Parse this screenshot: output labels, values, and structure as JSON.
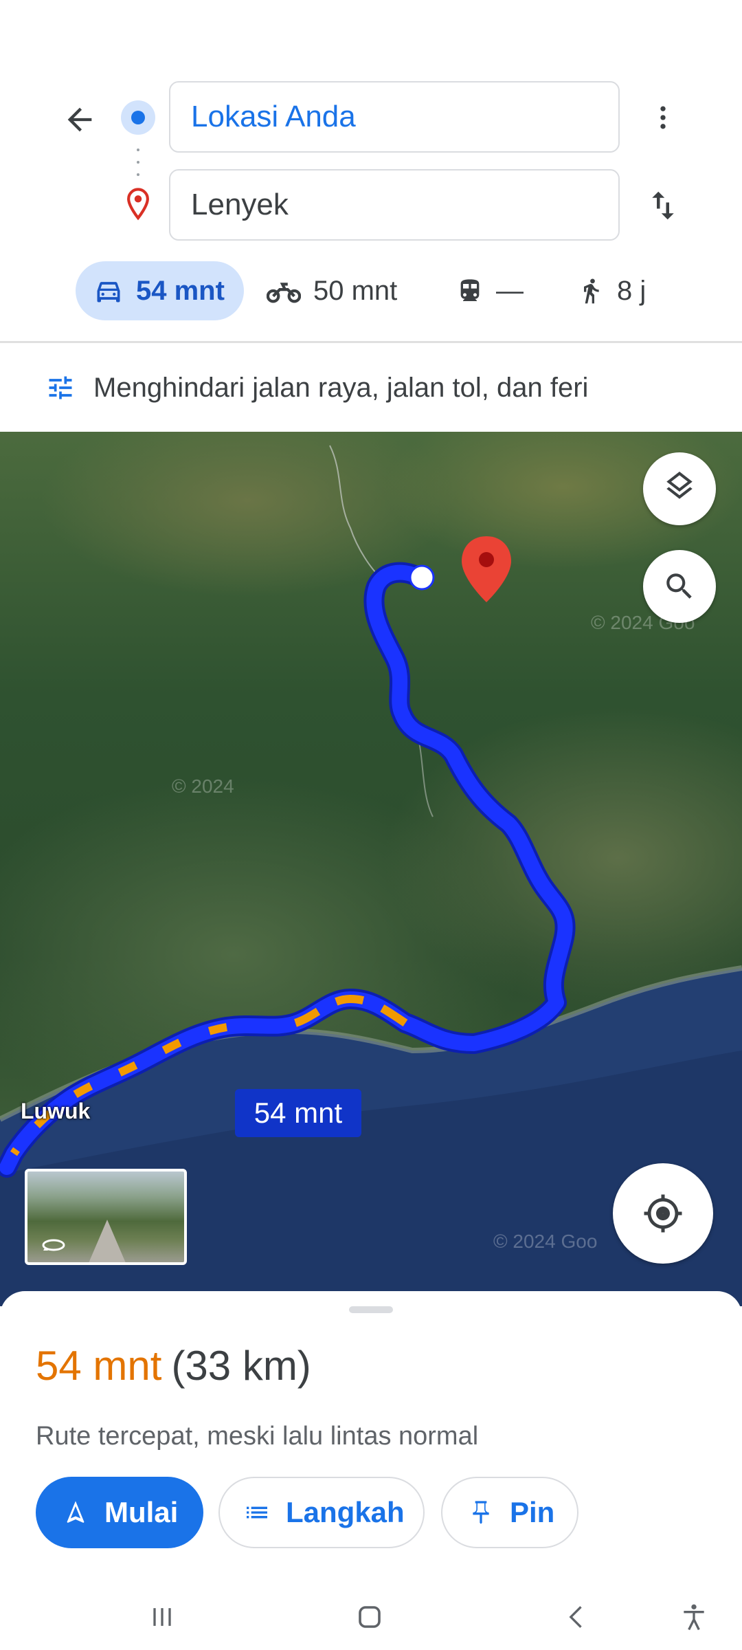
{
  "search": {
    "origin_value": "Lokasi Anda",
    "destination_value": "Lenyek"
  },
  "modes": [
    {
      "name": "car",
      "label": "54 mnt",
      "icon": "car-icon",
      "selected": true
    },
    {
      "name": "motorcycle",
      "label": "50 mnt",
      "icon": "motorcycle-icon",
      "selected": false
    },
    {
      "name": "transit",
      "label": "—",
      "icon": "train-icon",
      "selected": false
    },
    {
      "name": "walk",
      "label": "8 j",
      "icon": "walk-icon",
      "selected": false
    }
  ],
  "options": {
    "avoid_label": "Menghindari jalan raya, jalan tol, dan feri"
  },
  "map": {
    "route_label": "54 mnt",
    "place_label": "Luwuk",
    "watermarks": [
      "© 2024",
      "© 2024 Goo",
      "© 2024 Goo"
    ],
    "route_color": "#1a33ff",
    "traffic_color": "#f29900"
  },
  "sheet": {
    "duration": "54 mnt",
    "distance": "(33 km)",
    "description": "Rute tercepat, meski lalu lintas normal",
    "start_label": "Mulai",
    "steps_label": "Langkah",
    "pin_label": "Pin"
  },
  "colors": {
    "accent": "#1a73e8",
    "duration": "#e37400",
    "mode_selected_bg": "#d2e3fc"
  }
}
